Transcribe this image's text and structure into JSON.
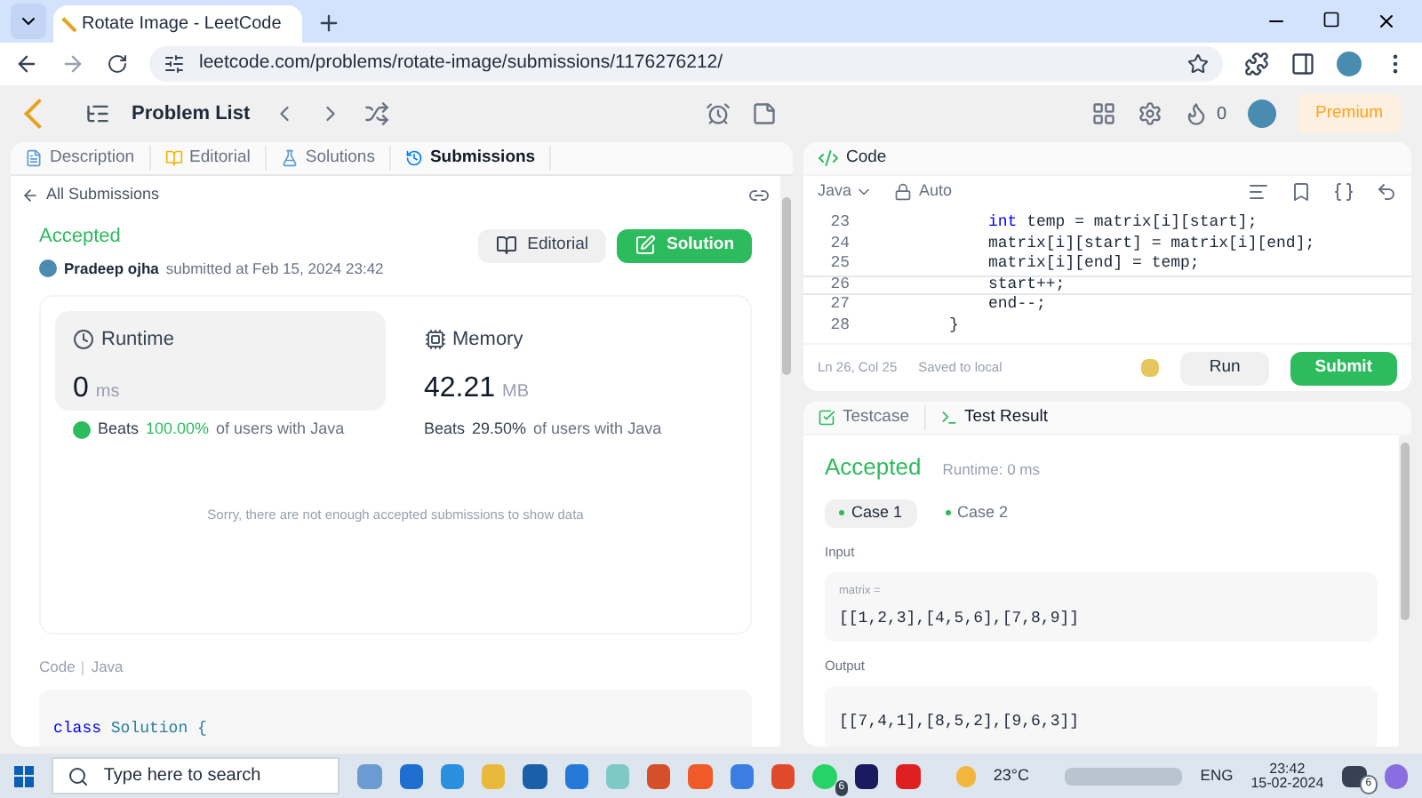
{
  "browser": {
    "tab_title": "Rotate Image - LeetCode",
    "url": "leetcode.com/problems/rotate-image/submissions/1176276212/"
  },
  "header": {
    "problem_list": "Problem List",
    "streak_count": "0",
    "premium": "Premium"
  },
  "left_tabs": [
    {
      "label": "Description",
      "selected": false
    },
    {
      "label": "Editorial",
      "selected": false
    },
    {
      "label": "Solutions",
      "selected": false
    },
    {
      "label": "Submissions",
      "selected": true
    }
  ],
  "back_link": "All Submissions",
  "submission": {
    "status": "Accepted",
    "author": "Pradeep ojha",
    "submitted_at": "submitted at Feb 15, 2024 23:42",
    "editorial_button": "Editorial",
    "solution_button": "Solution"
  },
  "runtime": {
    "label": "Runtime",
    "value": "0",
    "unit": "ms",
    "beats": "Beats",
    "percent": "100.00%",
    "suffix": "of users with Java",
    "highlight": true
  },
  "memory": {
    "label": "Memory",
    "value": "42.21",
    "unit": "MB",
    "beats": "Beats",
    "percent": "29.50%",
    "suffix": "of users with Java",
    "highlight": false
  },
  "chart_message": "Sorry, there are not enough accepted submissions to show data",
  "code_section": {
    "label": "Code",
    "language": "Java",
    "first_line": [
      {
        "text": "class ",
        "kind": "keyword"
      },
      {
        "text": "Solution {",
        "kind": "type"
      }
    ]
  },
  "editor": {
    "title": "Code",
    "language": "Java",
    "mode": "Auto",
    "lines": [
      {
        "number": "23",
        "current": false,
        "kind": "inner",
        "segments": [
          {
            "text": "int",
            "kind": "keyword"
          },
          {
            "text": " temp = matrix[i][start];",
            "kind": "plain"
          }
        ]
      },
      {
        "number": "24",
        "current": false,
        "kind": "inner",
        "segments": [
          {
            "text": "matrix[i][start] = matrix[i][end];",
            "kind": "plain"
          }
        ]
      },
      {
        "number": "25",
        "current": false,
        "kind": "inner",
        "segments": [
          {
            "text": "matrix[i][end] = temp;",
            "kind": "plain"
          }
        ]
      },
      {
        "number": "26",
        "current": true,
        "kind": "inner",
        "segments": [
          {
            "text": "start++;",
            "kind": "plain"
          }
        ]
      },
      {
        "number": "27",
        "current": false,
        "kind": "inner",
        "segments": [
          {
            "text": "end--;",
            "kind": "plain"
          }
        ]
      },
      {
        "number": "28",
        "current": false,
        "kind": "outer",
        "segments": [
          {
            "text": "}",
            "kind": "plain"
          }
        ]
      }
    ],
    "cursor": "Ln 26, Col 25",
    "saved": "Saved to local",
    "run": "Run",
    "submit": "Submit"
  },
  "bottom_tabs": [
    {
      "label": "Testcase",
      "selected": false
    },
    {
      "label": "Test Result",
      "selected": true
    }
  ],
  "result": {
    "status": "Accepted",
    "runtime": "Runtime: 0 ms",
    "cases": [
      {
        "label": "Case 1",
        "selected": true
      },
      {
        "label": "Case 2",
        "selected": false
      }
    ],
    "input_label": "Input",
    "param": "matrix =",
    "input_value": "[[1,2,3],[4,5,6],[7,8,9]]",
    "output_label": "Output",
    "output_value": "[[7,4,1],[8,5,2],[9,6,3]]"
  },
  "taskbar": {
    "search_placeholder": "Type here to search",
    "whatsapp_badge": "6",
    "weather": "23°C",
    "language": "ENG",
    "time": "23:42",
    "date": "15-02-2024",
    "notification_badge": "6"
  }
}
